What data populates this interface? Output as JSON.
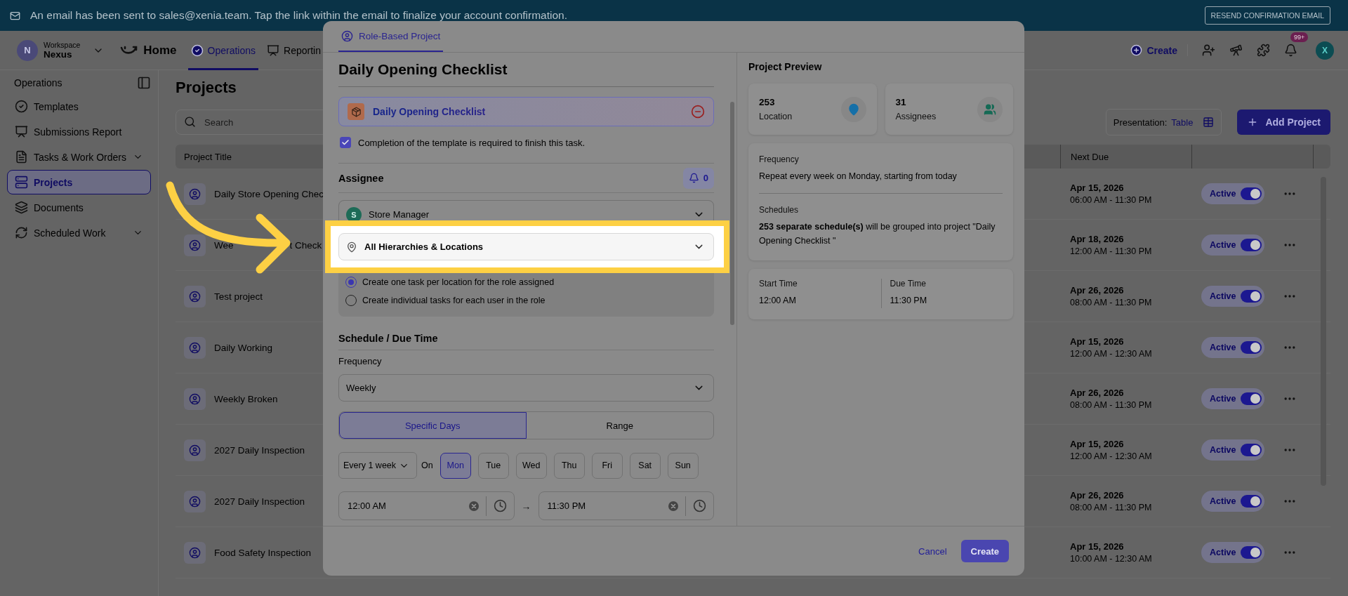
{
  "banner": {
    "message": "An email has been sent to sales@xenia.team. Tap the link within the email to finalize your account confirmation.",
    "button": "RESEND CONFIRMATION EMAIL"
  },
  "header": {
    "avatar": "N",
    "workspace_label": "Workspace",
    "workspace_name": "Nexus",
    "nav": [
      {
        "label": "Home",
        "selected": false
      },
      {
        "label": "Operations",
        "selected": true
      },
      {
        "label": "Reportin",
        "selected": false
      }
    ],
    "create": "Create",
    "notification_badge": "99+",
    "user_avatar": "X"
  },
  "sidebar": {
    "title": "Operations",
    "items": [
      {
        "label": "Templates",
        "selected": false,
        "expandable": false
      },
      {
        "label": "Submissions Report",
        "selected": false,
        "expandable": false
      },
      {
        "label": "Tasks & Work Orders",
        "selected": false,
        "expandable": true
      },
      {
        "label": "Projects",
        "selected": true,
        "expandable": false
      },
      {
        "label": "Documents",
        "selected": false,
        "expandable": false
      },
      {
        "label": "Scheduled Work",
        "selected": false,
        "expandable": true
      }
    ]
  },
  "page": {
    "title": "Projects",
    "search": {
      "placeholder": "Search"
    },
    "presentation": {
      "label": "Presentation:",
      "value": "Table"
    },
    "add_button": "Add Project"
  },
  "table": {
    "columns": [
      "Project Title",
      "Next Due"
    ],
    "rows": [
      {
        "title": "Daily Store Opening Chec",
        "date": "Apr 15, 2026",
        "time": "06:00 AM - 11:30 PM",
        "status": "Active",
        "on": true
      },
      {
        "title": "Wee",
        "title_after_arrow": "t Check",
        "date": "Apr 18, 2026",
        "time": "12:00 AM - 11:30 PM",
        "status": "Active",
        "on": true
      },
      {
        "title": "Test project",
        "date": "Apr 26, 2026",
        "time": "08:00 AM - 11:30 PM",
        "status": "Active",
        "on": true
      },
      {
        "title": "Daily Working",
        "date": "Apr 15, 2026",
        "time": "12:00 AM - 12:30 AM",
        "status": "Active",
        "on": true
      },
      {
        "title": "Weekly Broken",
        "date": "Apr 26, 2026",
        "time": "08:00 AM - 11:30 PM",
        "status": "Active",
        "on": true
      },
      {
        "title": "2027 Daily Inspection",
        "date": "Apr 15, 2026",
        "time": "12:00 AM - 12:30 AM",
        "status": "Active",
        "on": true
      },
      {
        "title": "2027 Daily Inspection",
        "date": "Apr 26, 2026",
        "time": "08:00 AM - 11:30 PM",
        "status": "Active",
        "on": true
      },
      {
        "title": "Food Safety Inspection",
        "date": "Apr 15, 2026",
        "time": "10:00 AM - 12:30 AM",
        "status": "Active",
        "on": true
      }
    ]
  },
  "modal": {
    "tab": {
      "label": "Role-Based Project",
      "selected": true
    },
    "title": "Daily Opening Checklist",
    "template": {
      "name": "Daily Opening Checklist"
    },
    "require_completion": {
      "label": "Completion of the template is required to finish this task.",
      "checked": true
    },
    "assignee": {
      "heading": "Assignee",
      "notification_count": "0",
      "role_avatar": "S",
      "role": "Store Manager",
      "location": "All Hierarchies & Locations",
      "highlighted": true,
      "options": [
        {
          "label": "Create one task per location for the role assigned",
          "selected": true
        },
        {
          "label": "Create individual tasks for each user in the role",
          "selected": false
        }
      ]
    },
    "schedule": {
      "heading": "Schedule / Due Time",
      "frequency_label": "Frequency",
      "frequency": "Weekly",
      "modes": [
        {
          "label": "Specific Days",
          "selected": true
        },
        {
          "label": "Range",
          "selected": false
        }
      ],
      "interval": "Every 1 week",
      "on_label": "On",
      "days": [
        {
          "label": "Mon",
          "selected": true
        },
        {
          "label": "Tue",
          "selected": false
        },
        {
          "label": "Wed",
          "selected": false
        },
        {
          "label": "Thu",
          "selected": false
        },
        {
          "label": "Fri",
          "selected": false
        },
        {
          "label": "Sat",
          "selected": false
        },
        {
          "label": "Sun",
          "selected": false
        }
      ],
      "start_time": "12:00 AM",
      "arrow": "→",
      "end_time": "11:30 PM"
    },
    "preview": {
      "title": "Project Preview",
      "stats": [
        {
          "value": "253",
          "label": "Location"
        },
        {
          "value": "31",
          "label": "Assignees"
        }
      ],
      "frequency_label": "Frequency",
      "frequency": "Repeat every week on Monday, starting from today",
      "schedules_label": "Schedules",
      "schedules": "**253 separate schedule(s)** will be grouped into project \"Daily Opening Checklist \"",
      "times": [
        {
          "label": "Start Time",
          "value": "12:00 AM"
        },
        {
          "label": "Due Time",
          "value": "11:30 PM"
        }
      ]
    },
    "footer": {
      "cancel": "Cancel",
      "create": "Create"
    }
  }
}
